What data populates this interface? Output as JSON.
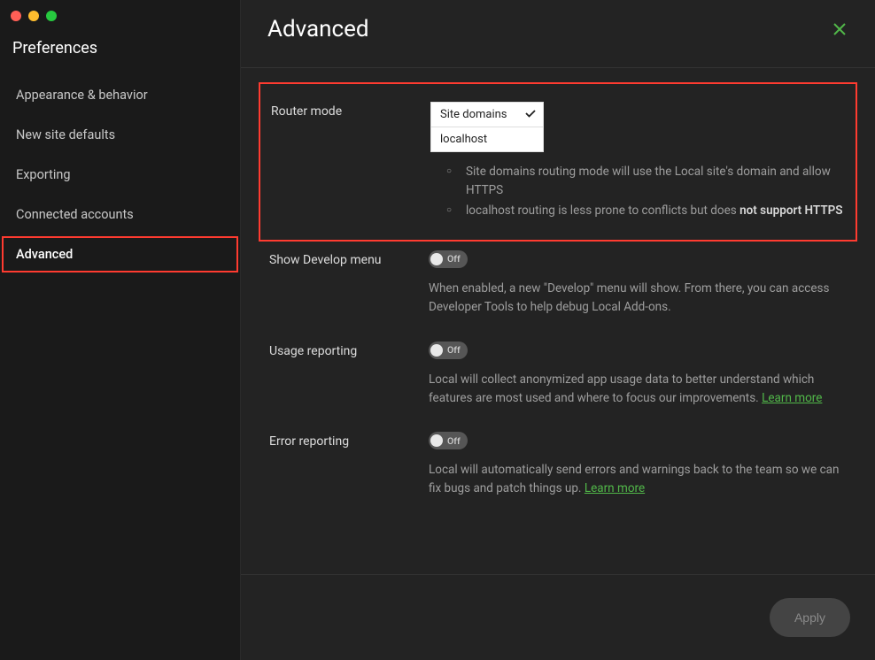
{
  "sidebar": {
    "title": "Preferences",
    "items": [
      {
        "label": "Appearance & behavior"
      },
      {
        "label": "New site defaults"
      },
      {
        "label": "Exporting"
      },
      {
        "label": "Connected accounts"
      },
      {
        "label": "Advanced"
      }
    ]
  },
  "header": {
    "title": "Advanced"
  },
  "settings": {
    "router": {
      "label": "Router mode",
      "selected": "Site domains",
      "option_localhost": "localhost",
      "bullet1_a": "Site domains ",
      "bullet1_b": "routing mode will use the Local site's domain and allow HTTPS",
      "bullet2_a": "localhost routing is less prone to conflicts but does ",
      "bullet2_strong": "not support HTTPS"
    },
    "develop": {
      "label": "Show Develop menu",
      "toggle": "Off",
      "desc": "When enabled, a new \"Develop\" menu will show. From there, you can access Developer Tools to help debug Local Add-ons."
    },
    "usage": {
      "label": "Usage reporting",
      "toggle": "Off",
      "desc": "Local will collect anonymized app usage data to better understand which features are most used and where to focus our improvements. ",
      "link": "Learn more"
    },
    "error": {
      "label": "Error reporting",
      "toggle": "Off",
      "desc": "Local will automatically send errors and warnings back to the team so we can fix bugs and patch things up. ",
      "link": "Learn more"
    }
  },
  "footer": {
    "apply": "Apply"
  }
}
